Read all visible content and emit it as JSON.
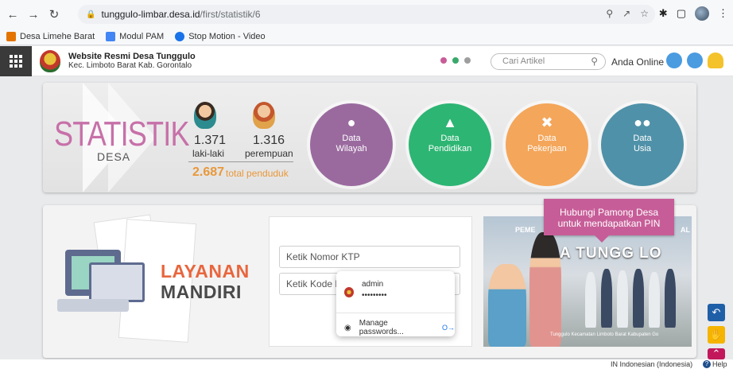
{
  "browser": {
    "url_host": "tunggulo-limbar.desa.id",
    "url_path": "/first/statistik/6",
    "bookmarks": [
      {
        "label": "Desa Limehe Barat",
        "color": "#e37400"
      },
      {
        "label": "Modul PAM",
        "color": "#4285f4"
      },
      {
        "label": "Stop Motion - Video",
        "color": "#1a73e8"
      }
    ]
  },
  "header": {
    "site_title": "Website Resmi Desa Tunggulo",
    "site_subtitle": "Kec. Limboto Barat Kab. Gorontalo",
    "search_placeholder": "Cari Artikel",
    "online_label": "Anda Online",
    "dot_colors": [
      "#c75d98",
      "#3aa86b",
      "#9e9e9e"
    ],
    "icon_colors": [
      "#4a9be0",
      "#4a9be0",
      "#f4c22b"
    ]
  },
  "stats": {
    "title": "STATISTIK",
    "subtitle": "DESA",
    "male_count": "1.371",
    "male_label": "laki-laki",
    "female_count": "1.316",
    "female_label": "perempuan",
    "total_count": "2.687",
    "total_label": "total penduduk",
    "categories": [
      {
        "icon": "map-pin-icon",
        "line1": "Data",
        "line2": "Wilayah",
        "color": "#9a6a9f"
      },
      {
        "icon": "graduation-cap-icon",
        "line1": "Data",
        "line2": "Pendidikan",
        "color": "#2db573"
      },
      {
        "icon": "tools-icon",
        "line1": "Data",
        "line2": "Pekerjaan",
        "color": "#f4a65a"
      },
      {
        "icon": "people-icon",
        "line1": "Data",
        "line2": "Usia",
        "color": "#4f91a8"
      }
    ]
  },
  "layanan": {
    "title1": "LAYANAN",
    "title2": "MANDIRI",
    "ktp_placeholder": "Ketik Nomor KTP",
    "kode_placeholder": "Ketik Kode P",
    "tooltip_line1": "Hubungi Pamong Desa",
    "tooltip_line2": "untuk mendapatkan PIN",
    "photo_banner": "PEME",
    "photo_banner_right": "AL",
    "photo_title": "A TUNGG  LO",
    "photo_footer": "Tunggulo Kecamatan Limboto Barat Kabupaten Go"
  },
  "password_popup": {
    "username": "admin",
    "password_mask": "•••••••••",
    "manage_label": "Manage passwords..."
  },
  "status_bar": {
    "language": "IN Indonesian (Indonesia)",
    "help": "Help"
  }
}
